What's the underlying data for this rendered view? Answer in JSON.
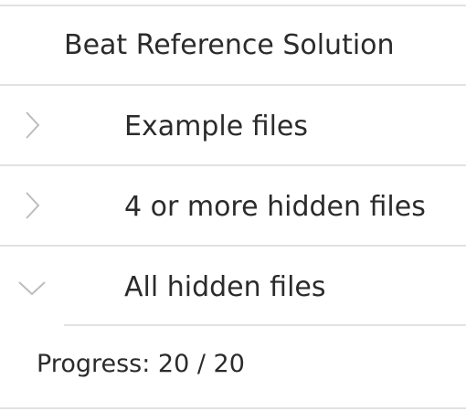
{
  "panel": {
    "title": "Beat Reference Solution"
  },
  "sections": [
    {
      "label": "Example files",
      "icon": "chevron-right-icon",
      "expanded": false
    },
    {
      "label": "4 or more hidden files",
      "icon": "chevron-right-icon",
      "expanded": false
    },
    {
      "label": "All hidden files",
      "icon": "chevron-down-icon",
      "expanded": true
    }
  ],
  "progress": {
    "text": "Progress: 20 / 20",
    "done": 20,
    "total": 20
  },
  "colors": {
    "divider": "#e2e2e2",
    "chevron": "#bdbdbd",
    "text": "#2b2b2b"
  }
}
